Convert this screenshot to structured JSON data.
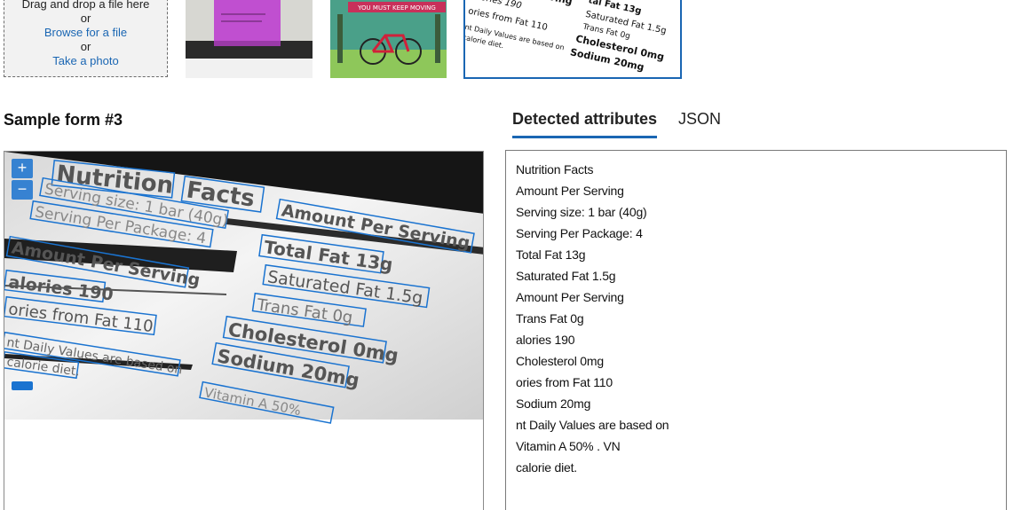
{
  "upload": {
    "drag_text": "Drag and drop a file here",
    "or_1": "or",
    "browse_link": "Browse for a file",
    "or_2": "or",
    "photo_link": "Take a photo"
  },
  "thumbnails": [
    {
      "name": "sticky-note-sample",
      "selected": false
    },
    {
      "name": "bicycle-sample",
      "caption": "YOU MUST KEEP MOVING",
      "selected": false
    },
    {
      "name": "nutrition-label-sample",
      "selected": true
    }
  ],
  "section": {
    "title": "Sample form #3"
  },
  "tabs": [
    {
      "label": "Detected attributes",
      "active": true
    },
    {
      "label": "JSON",
      "active": false
    }
  ],
  "zoom": {
    "in": "+",
    "out": "−"
  },
  "image_text": {
    "w1": "Nutrition",
    "w2": "Facts",
    "w3": "Amount Per Serving",
    "w4": "Serving size: 1 bar (40g)",
    "w5": "Serving Per Package: 4",
    "w6": "Amount Per Serving",
    "w7": "Total Fat 13g",
    "w8": "Saturated Fat 1.5g",
    "w9": "alories 190",
    "w10": "Trans Fat 0g",
    "w11": "ories from Fat 110",
    "w12": "Cholesterol 0mg",
    "w13": "nt Daily Values are based on",
    "w14": "Sodium 20mg",
    "w15": "calorie diet.",
    "w16": "Vitamin A 50%"
  },
  "detected_lines": [
    "Nutrition Facts",
    "Amount Per Serving",
    "Serving size: 1 bar (40g)",
    "Serving Per Package: 4",
    "Total Fat 13g",
    "Saturated Fat 1.5g",
    "Amount Per Serving",
    "Trans Fat 0g",
    "alories 190",
    "Cholesterol 0mg",
    "ories from Fat 110",
    "Sodium 20mg",
    "nt Daily Values are based on",
    "Vitamin A 50% . VN",
    "calorie diet."
  ],
  "colors": {
    "accent": "#1a66b3",
    "box": "#1a73d0"
  }
}
